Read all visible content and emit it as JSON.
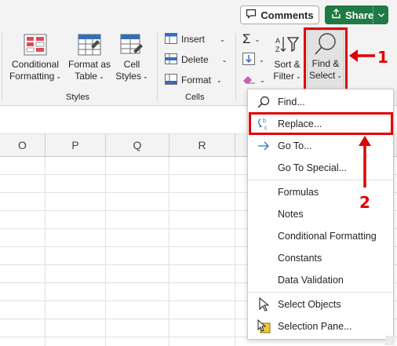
{
  "header": {
    "comments_label": "Comments",
    "share_label": "Share"
  },
  "ribbon": {
    "conditional_formatting": {
      "line1": "Conditional",
      "line2": "Formatting"
    },
    "format_as_table": {
      "line1": "Format as",
      "line2": "Table"
    },
    "cell_styles": {
      "line1": "Cell",
      "line2": "Styles"
    },
    "styles_group_label": "Styles",
    "cells": {
      "insert": "Insert",
      "delete": "Delete",
      "format": "Format",
      "group_label": "Cells"
    },
    "sort_filter": {
      "line1": "Sort &",
      "line2": "Filter"
    },
    "find_select": {
      "line1": "Find &",
      "line2": "Select"
    }
  },
  "columns": [
    "O",
    "P",
    "Q",
    "R"
  ],
  "menu": {
    "items": [
      {
        "label": "Find...",
        "icon": "magnifier-icon"
      },
      {
        "label": "Replace...",
        "icon": "replace-icon"
      },
      {
        "label": "Go To...",
        "icon": "arrow-right-icon"
      },
      {
        "label": "Go To Special...",
        "icon": ""
      },
      {
        "label": "Formulas",
        "icon": ""
      },
      {
        "label": "Notes",
        "icon": ""
      },
      {
        "label": "Conditional Formatting",
        "icon": ""
      },
      {
        "label": "Constants",
        "icon": ""
      },
      {
        "label": "Data Validation",
        "icon": ""
      },
      {
        "label": "Select Objects",
        "icon": "pointer-icon"
      },
      {
        "label": "Selection Pane...",
        "icon": "selection-pane-icon"
      }
    ]
  },
  "annotations": {
    "step1": "1",
    "step2": "2"
  },
  "colors": {
    "accent_red": "#e00000",
    "share_green": "#1f7a45"
  }
}
